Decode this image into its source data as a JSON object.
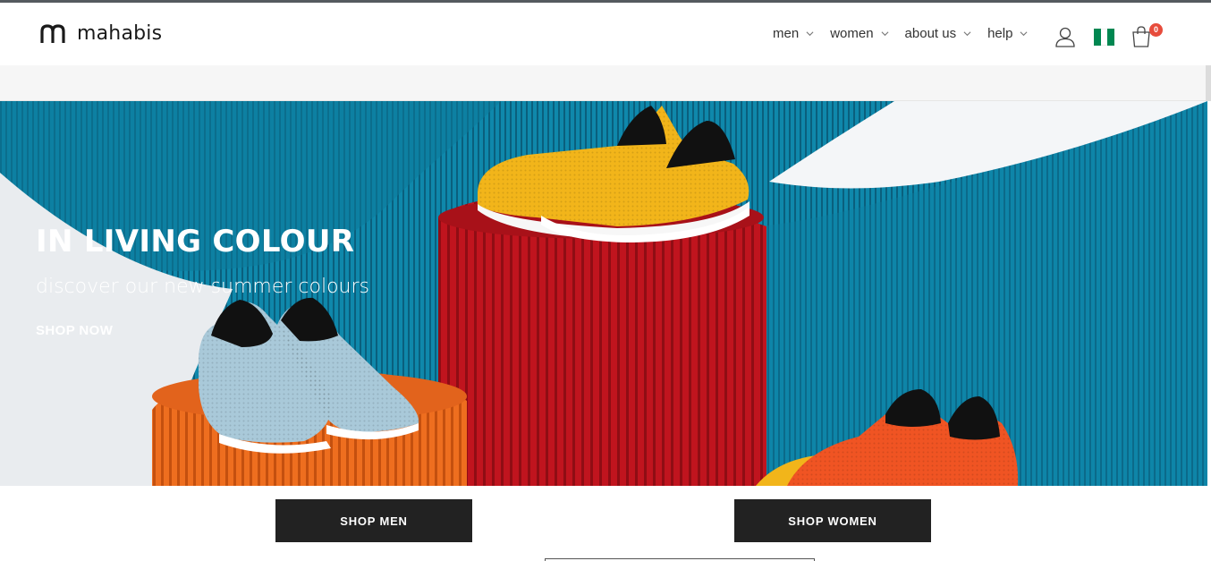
{
  "brand": {
    "name": "mahabis",
    "logo_icon": "mahabis-logo-icon"
  },
  "nav": {
    "items": [
      {
        "label": "men"
      },
      {
        "label": "women"
      },
      {
        "label": "about us"
      },
      {
        "label": "help"
      }
    ],
    "account_icon": "user-icon",
    "country_flag": {
      "icon": "nigeria-flag-icon",
      "colors": [
        "#008751",
        "#ffffff",
        "#008751"
      ]
    },
    "cart": {
      "icon": "shopping-bag-icon",
      "count": "0",
      "badge_color": "#e74c3c"
    }
  },
  "hero": {
    "title": "IN LIVING COLOUR",
    "subtitle": "discover our new summer colours",
    "cta": "SHOP NOW",
    "colors": {
      "backdrop": "#0e86a8",
      "pedestal_red": "#b5121b",
      "pedestal_orange": "#e8681c",
      "shoe_yellow": "#f2b51a",
      "shoe_blue": "#a9c9d9",
      "shoe_orange": "#f05423"
    }
  },
  "shop_buttons": {
    "men": "SHOP MEN",
    "women": "SHOP WOMEN"
  },
  "theme": {
    "button_bg": "#222222",
    "text": "#222222"
  }
}
